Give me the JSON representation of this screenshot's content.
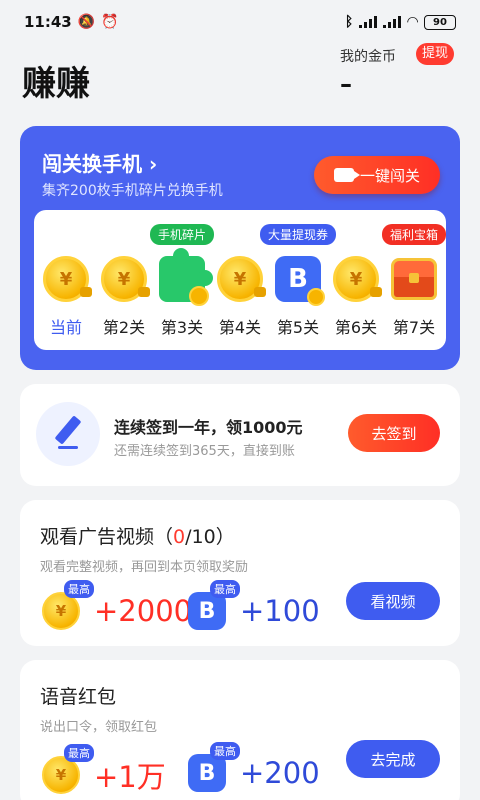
{
  "status_bar": {
    "time": "11:43",
    "battery": "90"
  },
  "header": {
    "title": "赚赚",
    "coin_label": "我的金币",
    "withdraw": "提现",
    "coin_value": "–"
  },
  "game": {
    "title": "闯关换手机 ›",
    "subtitle": "集齐200枚手机碎片兑换手机",
    "onekey_button": "一键闯关",
    "levels": [
      {
        "name": "当前",
        "tag": "",
        "icon": "coin-icon"
      },
      {
        "name": "第2关",
        "tag": "",
        "icon": "coin-icon"
      },
      {
        "name": "第3关",
        "tag": "手机碎片",
        "icon": "puzzle-icon"
      },
      {
        "name": "第4关",
        "tag": "",
        "icon": "coin-icon"
      },
      {
        "name": "第5关",
        "tag": "大量提现券",
        "icon": "ticket-icon"
      },
      {
        "name": "第6关",
        "tag": "",
        "icon": "coin-icon"
      },
      {
        "name": "第7关",
        "tag": "福利宝箱",
        "icon": "chest-icon"
      }
    ]
  },
  "signin": {
    "title": "连续签到一年，领1000元",
    "subtitle": "还需连续签到365天，直接到账",
    "button": "去签到"
  },
  "video_task": {
    "title_prefix": "观看广告视频（",
    "count": "0",
    "title_suffix": "/10）",
    "subtitle": "观看完整视频，再回到本页领取奖励",
    "badge": "最高",
    "coin_reward": "+2000",
    "ticket_reward": "+100",
    "button": "看视频"
  },
  "voice_task": {
    "title": "语音红包",
    "subtitle": "说出口令，领取红包",
    "badge": "最高",
    "coin_reward": "+1万",
    "ticket_reward": "+200",
    "button": "去完成"
  },
  "colors": {
    "brand_blue": "#4a63f0",
    "accent_red": "#ff2f25",
    "bg": "#f2f3f5"
  }
}
